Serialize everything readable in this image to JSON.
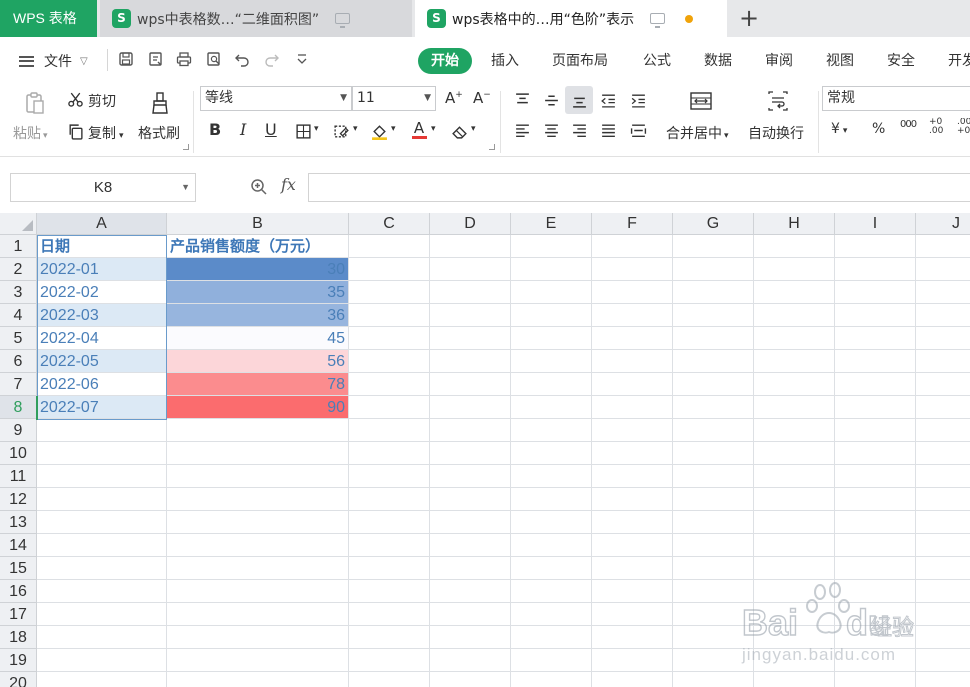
{
  "tabs": {
    "app_label": "WPS 表格",
    "docs": [
      {
        "badge": "S",
        "title": "wps中表格数…“二维面积图”"
      },
      {
        "badge": "S",
        "title": "wps表格中的…用“色阶”表示"
      }
    ],
    "new_tab": "+"
  },
  "menubar": {
    "file": "文件",
    "tabs": [
      "开始",
      "插入",
      "页面布局",
      "公式",
      "数据",
      "审阅",
      "视图",
      "安全",
      "开发"
    ],
    "active_tab": "开始"
  },
  "ribbon": {
    "paste": "粘贴",
    "cut": "剪切",
    "copy": "复制",
    "format_painter": "格式刷",
    "font_name": "等线",
    "font_size": "11",
    "bold": "B",
    "italic": "I",
    "underline": "U",
    "merge_center": "合并居中",
    "wrap_text": "自动换行",
    "number_format": "常规",
    "currency": "¥",
    "percent": "%",
    "thousands": "000",
    "dec_increase": "+0 .00",
    "dec_decrease": ".00 +0"
  },
  "formula_bar": {
    "name_box": "K8",
    "fx": "fx",
    "formula": ""
  },
  "sheet": {
    "columns": [
      "A",
      "B",
      "C",
      "D",
      "E",
      "F",
      "G",
      "H",
      "I",
      "J"
    ],
    "selected_column": "A",
    "rows": [
      "1",
      "2",
      "3",
      "4",
      "5",
      "6",
      "7",
      "8",
      "9",
      "10",
      "11",
      "12",
      "13",
      "14",
      "15",
      "16",
      "17",
      "18",
      "19",
      "20"
    ],
    "selected_row": "8",
    "header": {
      "a": "日期",
      "b": "产品销售额度（万元）"
    },
    "data": [
      {
        "a": "2022-01",
        "b": "30",
        "fill": "#5b8bc9"
      },
      {
        "a": "2022-02",
        "b": "35",
        "fill": "#90b0dc"
      },
      {
        "a": "2022-03",
        "b": "36",
        "fill": "#97b5de"
      },
      {
        "a": "2022-04",
        "b": "45",
        "fill": "#fbfbfe"
      },
      {
        "a": "2022-05",
        "b": "56",
        "fill": "#fcd6d9"
      },
      {
        "a": "2022-06",
        "b": "78",
        "fill": "#fb8c8e"
      },
      {
        "a": "2022-07",
        "b": "90",
        "fill": "#fb6c6e"
      }
    ],
    "a_fill_even": "#dce9f5",
    "a_fill_odd": "#ffffff"
  },
  "watermark": {
    "text1": "Bai",
    "text2": "du",
    "text3": "经验",
    "url": "jingyan.baidu.com"
  }
}
